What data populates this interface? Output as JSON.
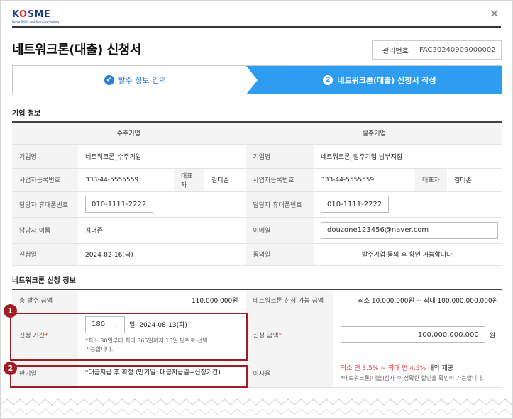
{
  "logo": {
    "main": "KSME",
    "sub": "Korea SMEs and Startups Agency"
  },
  "title": "네트워크론(대출) 신청서",
  "mgmt": {
    "label": "관리번호",
    "value": "FAC20240909000002"
  },
  "steps": [
    {
      "label": "발주 정보 입력",
      "marker": "✔"
    },
    {
      "label": "네트워크론(대출) 신청서 작성",
      "marker": "2"
    }
  ],
  "company_section": {
    "title": "기업 정보",
    "supplier_header": "수주기업",
    "buyer_header": "발주기업",
    "rows": {
      "company_name": {
        "label": "기업명",
        "supplier": "네트워크론_수주기업",
        "buyer": "네트워크론_발주기업 남부지점"
      },
      "biz_no": {
        "label": "사업자등록번호",
        "supplier": "333-44-5555559",
        "buyer": "333-44-5555559",
        "rep_label": "대표자",
        "supplier_rep": "김더존",
        "buyer_rep": "김더존"
      },
      "phone": {
        "label": "담당자 휴대폰번호",
        "supplier": "010-1111-2222",
        "buyer": "010-1111-2222"
      },
      "manager": {
        "label": "담당자 이름",
        "supplier": "김더존",
        "email_label": "이메일",
        "email": "douzone123456@naver.com"
      },
      "apply_date": {
        "label": "신청일",
        "supplier": "2024-02-16(금)",
        "consent_label": "동의일",
        "consent": "발주기업 동의 후 확인 가능합니다."
      }
    }
  },
  "loan_section": {
    "title": "네트워크론 신청 정보",
    "total_label": "총 발주 금액",
    "total_value": "110,000,000원",
    "range_label": "네트워크론 신청 가능 금액",
    "range_value": "최소 10,000,000원 ~ 최대 100,000,000,000원",
    "period_label": "신청 기간",
    "period_select": "180",
    "period_unit": "일",
    "period_date": "2024-08-13(화)",
    "period_hint": "*최소 30일부터 최대 365일까지 15일 단위로 선택 가능합니다.",
    "amount_label": "신청 금액",
    "amount_value": "100,000,000,000",
    "amount_unit": "원",
    "maturity_label": "만기일",
    "maturity_value": "*대금지급 후 확정 (만기일: 대금지급일+신청기간)",
    "rate_label": "이자율",
    "rate_text": "최소 연 3.5% ~ 최대 연 4.5%",
    "rate_suffix": " 내외 제공",
    "rate_hint": "*네트워크론(대출)심사 후 정확한 할인율 확인이 가능합니다."
  },
  "callouts": [
    "1",
    "2"
  ],
  "colors": {
    "accent": "#2e9cf0",
    "callout": "#a01d24",
    "brand": "#1d3f8f"
  }
}
